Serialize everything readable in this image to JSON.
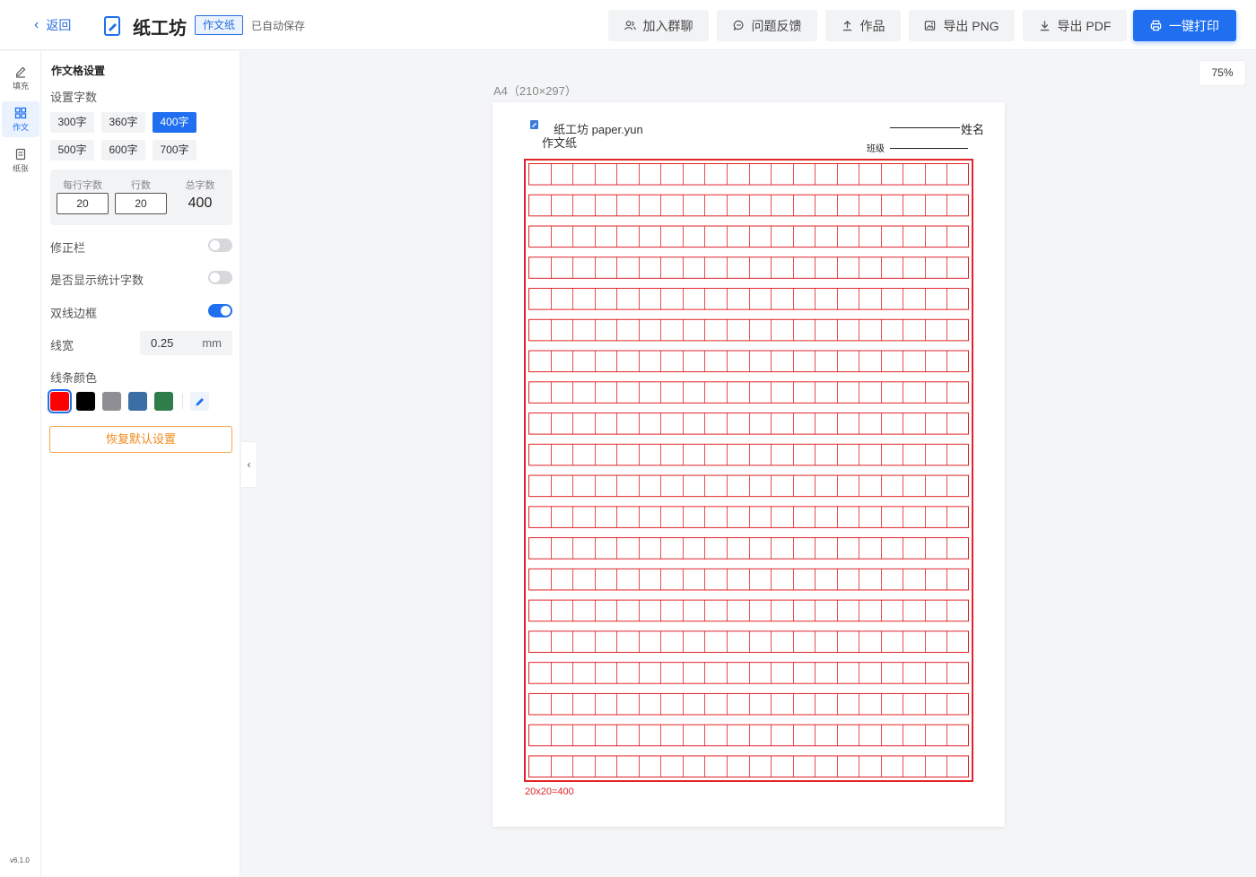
{
  "header": {
    "back_label": "返回",
    "app_title": "纸工坊",
    "type_tag": "作文纸",
    "save_status": "已自动保存",
    "buttons": {
      "join_group": "加入群聊",
      "feedback": "问题反馈",
      "works": "作品",
      "export_png": "导出 PNG",
      "export_pdf": "导出 PDF",
      "print": "一键打印"
    }
  },
  "rail": {
    "items": [
      {
        "label": "填充",
        "icon": "pencil-icon"
      },
      {
        "label": "作文",
        "icon": "grid-icon"
      },
      {
        "label": "纸张",
        "icon": "page-icon"
      }
    ],
    "active_index": 1,
    "version": "v6.1.0"
  },
  "settings": {
    "title": "作文格设置",
    "count_label": "设置字数",
    "count_options": [
      "300字",
      "360字",
      "400字",
      "500字",
      "600字",
      "700字"
    ],
    "selected_count": "400字",
    "stats": {
      "per_row_label": "每行字数",
      "rows_label": "行数",
      "total_label": "总字数",
      "per_row": "20",
      "rows": "20",
      "total": "400"
    },
    "correction_bar_label": "修正栏",
    "correction_bar_on": false,
    "show_count_label": "是否显示统计字数",
    "show_count_on": false,
    "double_border_label": "双线边框",
    "double_border_on": true,
    "line_width_label": "线宽",
    "line_width_value": "0.25",
    "line_width_unit": "mm",
    "line_color_label": "线条颜色",
    "colors": [
      "#ff0000",
      "#000000",
      "#8e8e93",
      "#3b6ea5",
      "#2e7d4a"
    ],
    "selected_color": "#ff0000",
    "reset_label": "恢复默认设置"
  },
  "canvas": {
    "zoom": "75%",
    "paper_size": "A4（210×297）",
    "brand_text": "纸工坊 paper.yun",
    "paper_type": "作文纸",
    "name_label": "姓名",
    "class_label": "班级",
    "grid_caption": "20x20=400",
    "grid_cols": 20,
    "grid_rows": 20,
    "grid_color": "#e0242a"
  }
}
